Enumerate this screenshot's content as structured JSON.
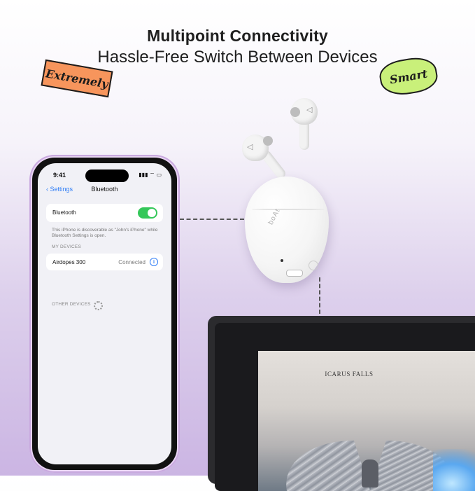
{
  "headline": {
    "title": "Multipoint Connectivity",
    "subtitle": "Hassle-Free Switch Between Devices"
  },
  "stickers": {
    "left": "Extremely",
    "right": "Smart"
  },
  "phone": {
    "status": {
      "time": "9:41",
      "icons": "▮▮▮ ⌔ ▭"
    },
    "nav": {
      "back_label": "Settings",
      "title": "Bluetooth"
    },
    "bluetooth": {
      "label": "Bluetooth",
      "enabled": true,
      "note": "This iPhone is discoverable as \"John's iPhone\" while Bluetooth Settings is open."
    },
    "my_devices": {
      "header": "MY DEVICES",
      "items": [
        {
          "name": "Airdopes 300",
          "status": "Connected",
          "icon": "info-icon"
        }
      ]
    },
    "other_devices": {
      "header": "OTHER DEVICES",
      "icon": "loading-spinner-icon"
    }
  },
  "earbuds": {
    "brand": "boAt",
    "logo_icon": "boat-logo-icon"
  },
  "laptop": {
    "album_title": "ICARUS FALLS"
  },
  "colors": {
    "toggle_on": "#34c759",
    "ios_blue": "#2f7df6",
    "sticker_orange": "#f7955c",
    "sticker_green": "#c9f07a",
    "background_purple": "#cbb5e3"
  }
}
